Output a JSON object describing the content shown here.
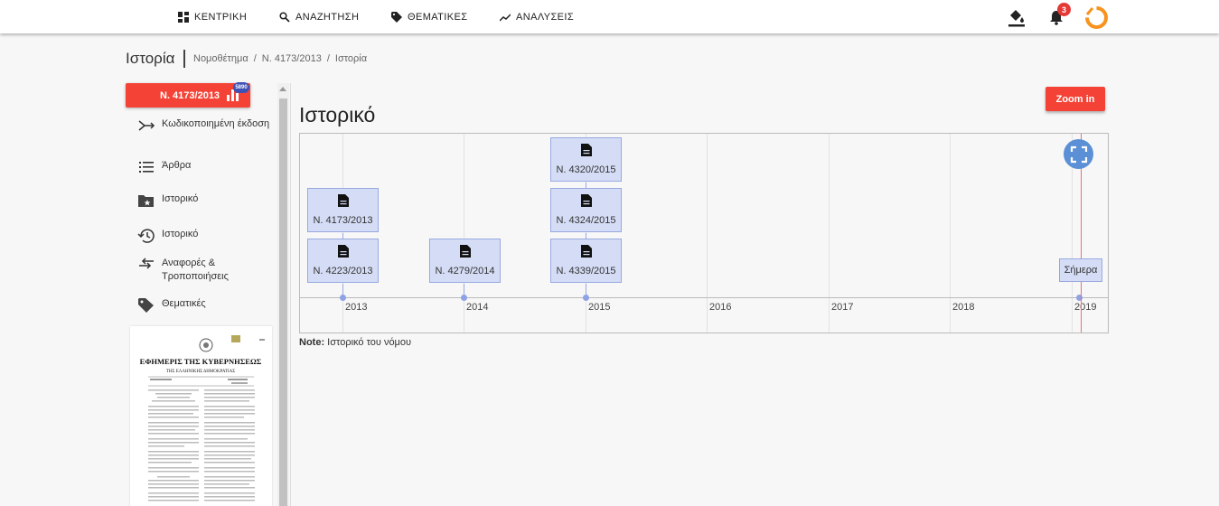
{
  "nav": {
    "items": [
      {
        "label": "ΚΕΝΤΡΙΚΗ",
        "icon": "dashboard-icon"
      },
      {
        "label": "ΑΝΑΖΗΤΗΣΗ",
        "icon": "search-icon"
      },
      {
        "label": "ΘΕΜΑΤΙΚΕΣ",
        "icon": "tag-icon"
      },
      {
        "label": "ΑΝΑΛΥΣΕΙΣ",
        "icon": "trending-icon"
      }
    ],
    "notification_count": "3",
    "accent_color": "#f44336",
    "logo_color": "#f7931e"
  },
  "header": {
    "title": "Ιστορία",
    "breadcrumb": [
      "Νομοθέτημα",
      "Ν. 4173/2013",
      "Ιστορία"
    ]
  },
  "sidebar": {
    "law_button": "Ν. 4173/2013",
    "views_badge": "5890",
    "items": [
      {
        "label": "Κωδικοποιημένη έκδοση",
        "icon": "merge-icon"
      },
      {
        "label": "Άρθρα",
        "icon": "list-icon"
      },
      {
        "label": "Ιστορικό",
        "icon": "folder-star-icon"
      },
      {
        "label": "Ιστορικό",
        "icon": "history-icon"
      },
      {
        "label": "Αναφορές & Τροποποιήσεις",
        "icon": "swap-icon"
      },
      {
        "label": "Θεματικές",
        "icon": "tag-icon"
      }
    ],
    "doc_preview": {
      "title": "ΕΦΗΜΕΡΙΣ ΤΗΣ ΚΥΒΕΡΝΗΣΕΩΣ",
      "subtitle": "ΤΗΣ ΕΛΛΗΝΙΚΗΣ ΔΗΜΟΚΡΑΤΙΑΣ"
    }
  },
  "main": {
    "title": "Ιστορικό",
    "zoom_button": "Zoom in",
    "timeline": {
      "years": [
        "2013",
        "2014",
        "2015",
        "2016",
        "2017",
        "2018",
        "2019"
      ],
      "events": [
        {
          "label": "Ν. 4173/2013",
          "year": "2013"
        },
        {
          "label": "Ν. 4223/2013",
          "year": "2013"
        },
        {
          "label": "Ν. 4279/2014",
          "year": "2014"
        },
        {
          "label": "Ν. 4320/2015",
          "year": "2015"
        },
        {
          "label": "Ν. 4324/2015",
          "year": "2015"
        },
        {
          "label": "Ν. 4339/2015",
          "year": "2015"
        }
      ],
      "today_label": "Σήμερα"
    },
    "note_label": "Note:",
    "note_text": "Ιστορικό του νόμου"
  }
}
